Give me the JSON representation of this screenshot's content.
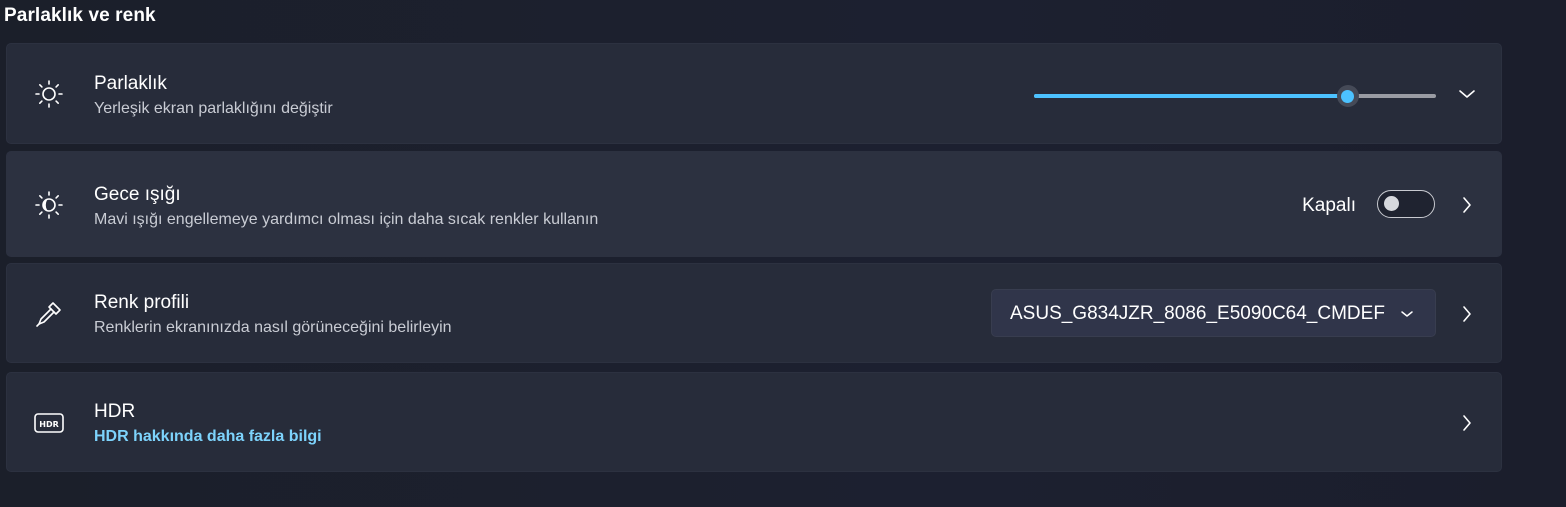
{
  "section": {
    "title": "Parlaklık ve renk"
  },
  "brightness": {
    "title": "Parlaklık",
    "subtitle": "Yerleşik ekran parlaklığını değiştir",
    "level_percent": 78,
    "icon": "sun-icon"
  },
  "night_light": {
    "title": "Gece ışığı",
    "subtitle": "Mavi ışığı engellemeye yardımcı olması için daha sıcak renkler kullanın",
    "state_label": "Kapalı",
    "enabled": false,
    "icon": "night-light-icon"
  },
  "color_profile": {
    "title": "Renk profili",
    "subtitle": "Renklerin ekranınızda nasıl görüneceğini belirleyin",
    "selected": "ASUS_G834JZR_8086_E5090C64_CMDEF",
    "icon": "eyedropper-icon"
  },
  "hdr": {
    "title": "HDR",
    "link": "HDR hakkında daha fazla bilgi",
    "icon": "hdr-icon"
  },
  "colors": {
    "accent": "#4cc2ff",
    "link": "#7dd3fc"
  }
}
